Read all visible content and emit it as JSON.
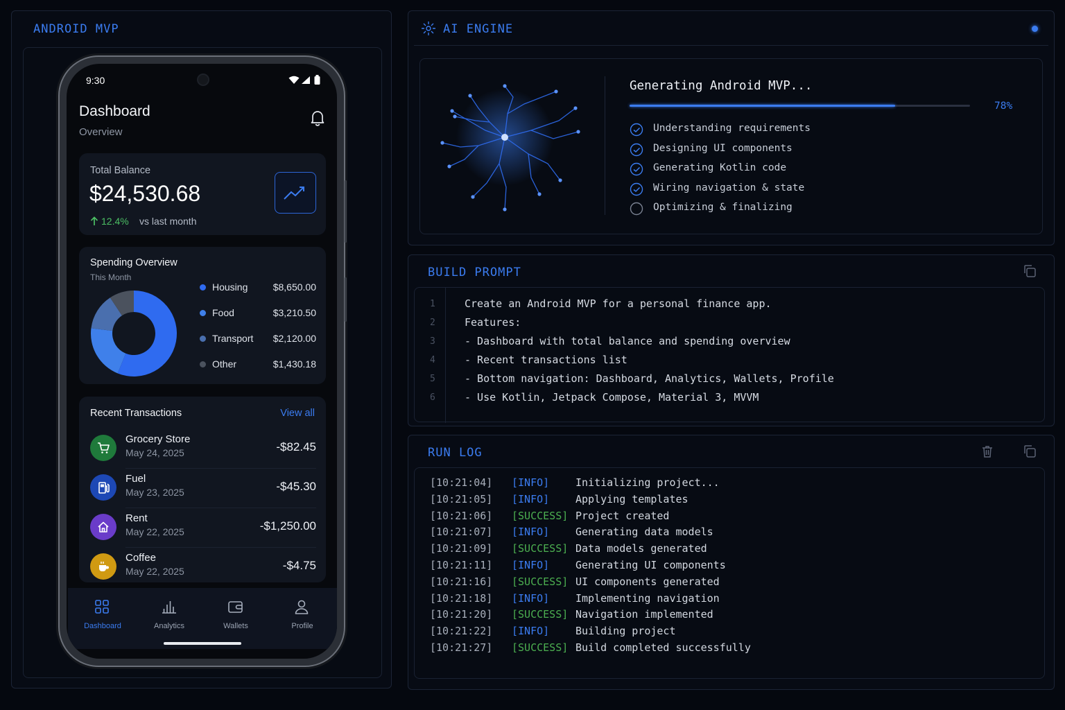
{
  "left_panel": {
    "title": "ANDROID MVP"
  },
  "phone": {
    "time": "9:30",
    "header": {
      "title": "Dashboard",
      "subtitle": "Overview"
    },
    "balance": {
      "label": "Total Balance",
      "amount": "$24,530.68",
      "change": "12.4%",
      "change_suffix": "vs last month"
    },
    "spending": {
      "title": "Spending Overview",
      "subtitle": "This Month",
      "categories": [
        {
          "name": "Housing",
          "value": "$8,650.00",
          "color": "#2f6bf0"
        },
        {
          "name": "Food",
          "value": "$3,210.50",
          "color": "#3f80ea"
        },
        {
          "name": "Transport",
          "value": "$2,120.00",
          "color": "#4a6fae"
        },
        {
          "name": "Other",
          "value": "$1,430.18",
          "color": "#4b525e"
        }
      ]
    },
    "transactions": {
      "title": "Recent Transactions",
      "view_all": "View all",
      "items": [
        {
          "name": "Grocery Store",
          "date": "May 24, 2025",
          "amount": "-$82.45",
          "icon": "cart-icon",
          "color": "#1f7a3b"
        },
        {
          "name": "Fuel",
          "date": "May 23, 2025",
          "amount": "-$45.30",
          "icon": "fuel-icon",
          "color": "#1d48b5"
        },
        {
          "name": "Rent",
          "date": "May 22, 2025",
          "amount": "-$1,250.00",
          "icon": "home-icon",
          "color": "#6a3cc9"
        },
        {
          "name": "Coffee",
          "date": "May 22, 2025",
          "amount": "-$4.75",
          "icon": "coffee-icon",
          "color": "#d09a12"
        }
      ]
    },
    "nav": [
      {
        "label": "Dashboard",
        "icon": "grid-icon",
        "active": true
      },
      {
        "label": "Analytics",
        "icon": "bar-chart-icon",
        "active": false
      },
      {
        "label": "Wallets",
        "icon": "wallet-icon",
        "active": false
      },
      {
        "label": "Profile",
        "icon": "person-icon",
        "active": false
      }
    ]
  },
  "ai_engine": {
    "title": "AI ENGINE",
    "status": "Generating Android MVP...",
    "progress": 78,
    "progress_label": "78%",
    "steps": [
      {
        "label": "Understanding requirements",
        "done": true
      },
      {
        "label": "Designing UI components",
        "done": true
      },
      {
        "label": "Generating Kotlin code",
        "done": true
      },
      {
        "label": "Wiring navigation & state",
        "done": true
      },
      {
        "label": "Optimizing & finalizing",
        "done": false
      }
    ]
  },
  "build_prompt": {
    "title": "BUILD PROMPT",
    "lines": [
      "Create an Android MVP for a personal finance app.",
      "Features:",
      "- Dashboard with total balance and spending overview",
      "- Recent transactions list",
      "- Bottom navigation: Dashboard, Analytics, Wallets, Profile",
      "- Use Kotlin, Jetpack Compose, Material 3, MVVM"
    ],
    "line_numbers": [
      "1",
      "2",
      "3",
      "4",
      "5",
      "6"
    ]
  },
  "run_log": {
    "title": "RUN LOG",
    "entries": [
      {
        "time": "[10:21:04]",
        "level": "[INFO]",
        "msg": "Initializing project..."
      },
      {
        "time": "[10:21:05]",
        "level": "[INFO]",
        "msg": "Applying templates"
      },
      {
        "time": "[10:21:06]",
        "level": "[SUCCESS]",
        "msg": "Project created"
      },
      {
        "time": "[10:21:07]",
        "level": "[INFO]",
        "msg": "Generating data models"
      },
      {
        "time": "[10:21:09]",
        "level": "[SUCCESS]",
        "msg": "Data models generated"
      },
      {
        "time": "[10:21:11]",
        "level": "[INFO]",
        "msg": "Generating UI components"
      },
      {
        "time": "[10:21:16]",
        "level": "[SUCCESS]",
        "msg": "UI components generated"
      },
      {
        "time": "[10:21:18]",
        "level": "[INFO]",
        "msg": "Implementing navigation"
      },
      {
        "time": "[10:21:20]",
        "level": "[SUCCESS]",
        "msg": "Navigation implemented"
      },
      {
        "time": "[10:21:22]",
        "level": "[INFO]",
        "msg": "Building project"
      },
      {
        "time": "[10:21:27]",
        "level": "[SUCCESS]",
        "msg": "Build completed successfully"
      }
    ]
  },
  "colors": {
    "accent": "#3b7cf0",
    "success": "#4caf50",
    "info": "#3b7cf0"
  }
}
